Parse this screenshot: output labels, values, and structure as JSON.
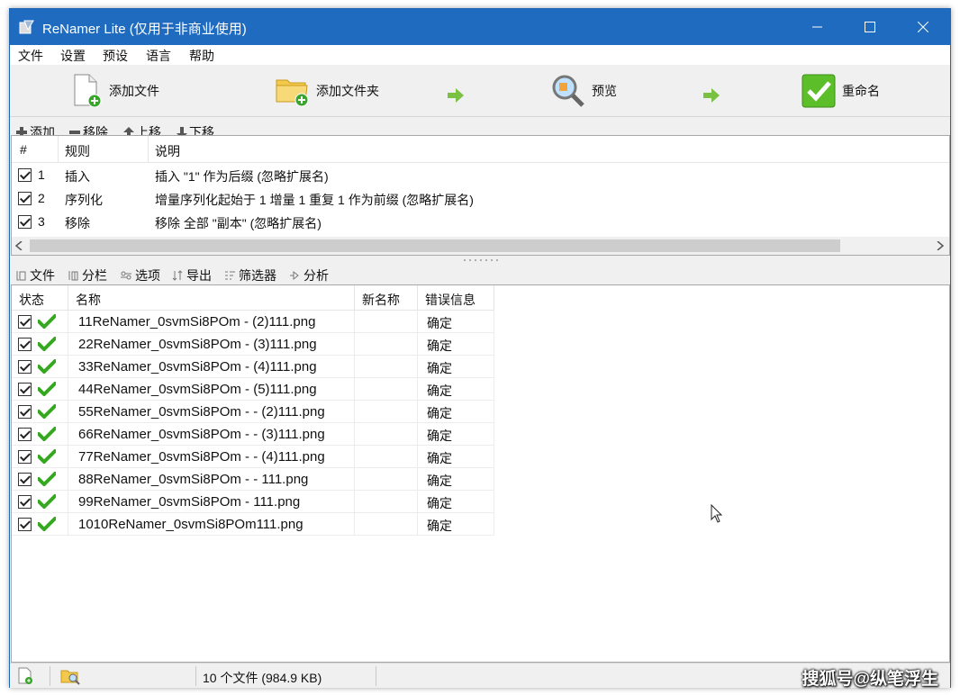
{
  "window": {
    "title": "ReNamer Lite   (仅用于非商业使用)"
  },
  "menu": [
    "文件",
    "设置",
    "预设",
    "语言",
    "帮助"
  ],
  "toolbar": {
    "add_files": "添加文件",
    "add_folder": "添加文件夹",
    "preview": "预览",
    "rename": "重命名"
  },
  "rule_toolbar": {
    "add": "添加",
    "remove": "移除",
    "move_up": "上移",
    "move_down": "下移"
  },
  "rules": {
    "headers": {
      "num": "#",
      "rule": "规则",
      "desc": "说明"
    },
    "rows": [
      {
        "num": "1",
        "rule": "插入",
        "desc": "插入 \"1\" 作为后缀 (忽略扩展名)"
      },
      {
        "num": "2",
        "rule": "序列化",
        "desc": "增量序列化起始于 1 增量 1 重复 1 作为前缀 (忽略扩展名)"
      },
      {
        "num": "3",
        "rule": "移除",
        "desc": "移除 全部 \"副本\" (忽略扩展名)"
      }
    ]
  },
  "file_toolbar": {
    "files": "文件",
    "columns": "分栏",
    "options": "选项",
    "export": "导出",
    "filter": "筛选器",
    "analyze": "分析"
  },
  "files": {
    "headers": {
      "state": "状态",
      "name": "名称",
      "new_name": "新名称",
      "error": "错误信息"
    },
    "rows": [
      {
        "name": "11ReNamer_0svmSi8POm -  (2)111.png",
        "new_name": "",
        "error": "确定"
      },
      {
        "name": "22ReNamer_0svmSi8POm -  (3)111.png",
        "new_name": "",
        "error": "确定"
      },
      {
        "name": "33ReNamer_0svmSi8POm -  (4)111.png",
        "new_name": "",
        "error": "确定"
      },
      {
        "name": "44ReNamer_0svmSi8POm -  (5)111.png",
        "new_name": "",
        "error": "确定"
      },
      {
        "name": "55ReNamer_0svmSi8POm -  -  (2)111.png",
        "new_name": "",
        "error": "确定"
      },
      {
        "name": "66ReNamer_0svmSi8POm -  -  (3)111.png",
        "new_name": "",
        "error": "确定"
      },
      {
        "name": "77ReNamer_0svmSi8POm -  -  (4)111.png",
        "new_name": "",
        "error": "确定"
      },
      {
        "name": "88ReNamer_0svmSi8POm -  - 111.png",
        "new_name": "",
        "error": "确定"
      },
      {
        "name": "99ReNamer_0svmSi8POm - 111.png",
        "new_name": "",
        "error": "确定"
      },
      {
        "name": "1010ReNamer_0svmSi8POm111.png",
        "new_name": "",
        "error": "确定"
      }
    ]
  },
  "status": {
    "count": "10 个文件 (984.9 KB)"
  },
  "watermark": "搜狐号@纵笔浮生",
  "colors": {
    "titlebar": "#1f6bbf",
    "check_green": "#35a820",
    "arrow_green": "#7ac142"
  }
}
